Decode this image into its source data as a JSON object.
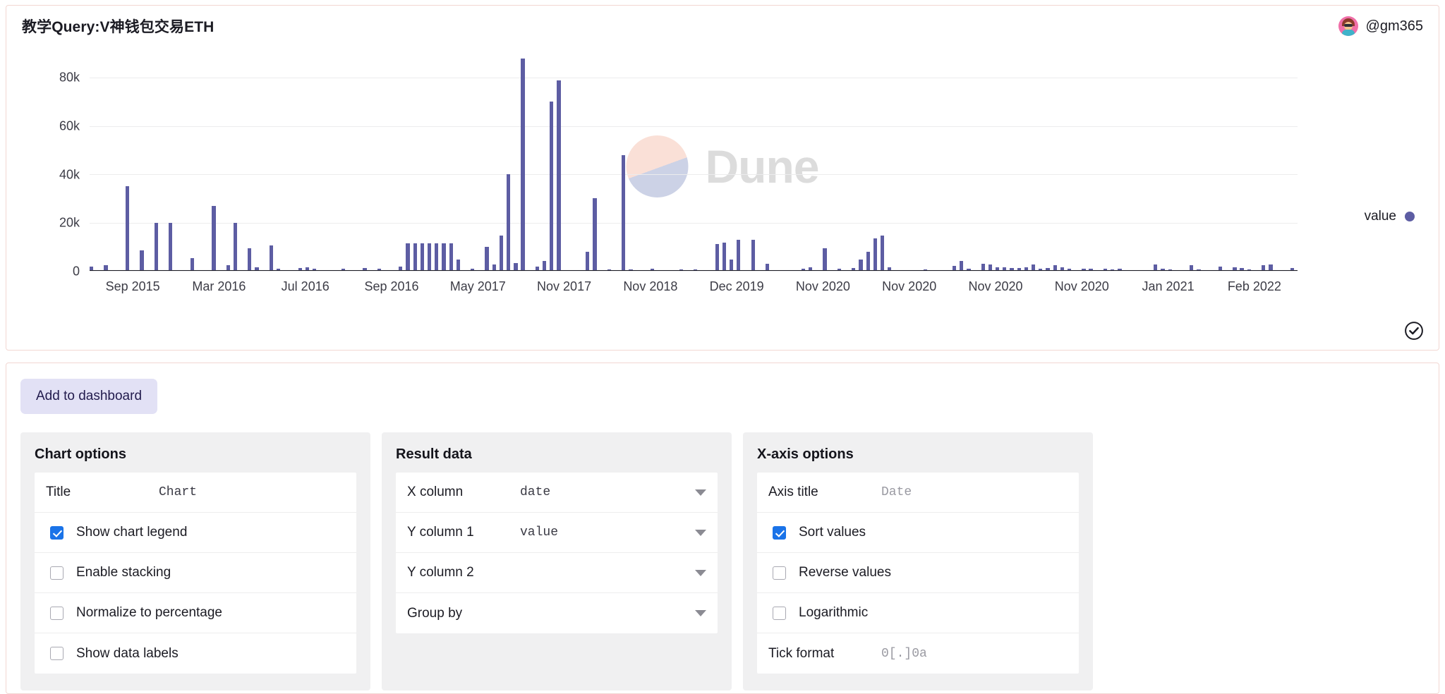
{
  "header": {
    "title": "教学Query:V神钱包交易ETH",
    "user_handle": "@gm365",
    "avatar_name": "user-avatar"
  },
  "chart_data": {
    "type": "bar",
    "title": "教学Query:V神钱包交易ETH",
    "xlabel": "",
    "ylabel": "",
    "ylim": [
      0,
      90000
    ],
    "grid": true,
    "legend_position": "right",
    "legend": [
      "value"
    ],
    "series_color": "#5d5da3",
    "ytick_labels": [
      "0",
      "20k",
      "40k",
      "60k",
      "80k"
    ],
    "ytick_values": [
      0,
      20000,
      40000,
      60000,
      80000
    ],
    "xtick_labels": [
      "Sep 2015",
      "Mar 2016",
      "Jul 2016",
      "Sep 2016",
      "May 2017",
      "Nov 2017",
      "Nov 2018",
      "Dec 2019",
      "Nov 2020",
      "Nov 2020",
      "Nov 2020",
      "Nov 2020",
      "Jan 2021",
      "Feb 2022"
    ],
    "series": [
      {
        "name": "value",
        "values": [
          1800,
          0,
          2400,
          0,
          0,
          35000,
          0,
          8500,
          0,
          20000,
          0,
          20000,
          0,
          0,
          5200,
          0,
          0,
          27000,
          0,
          2200,
          20000,
          0,
          9500,
          1400,
          0,
          10500,
          900,
          0,
          0,
          1200,
          1400,
          900,
          0,
          0,
          0,
          800,
          0,
          0,
          1100,
          0,
          900,
          0,
          0,
          1900,
          11500,
          11500,
          11500,
          11500,
          11500,
          11500,
          11500,
          4800,
          0,
          1000,
          0,
          9800,
          2600,
          14500,
          40000,
          3100,
          88000,
          0,
          1800,
          4200,
          70000,
          79000,
          0,
          0,
          0,
          7800,
          30000,
          0,
          700,
          0,
          48000,
          500,
          0,
          0,
          900,
          0,
          0,
          0,
          600,
          0,
          700,
          0,
          0,
          11000,
          11800,
          4800,
          13000,
          0,
          12800,
          0,
          3000,
          0,
          0,
          0,
          0,
          800,
          1400,
          0,
          9400,
          0,
          800,
          0,
          1100,
          4600,
          8000,
          13500,
          14500,
          1600,
          0,
          0,
          0,
          0,
          700,
          0,
          0,
          0,
          2100,
          4200,
          800,
          0,
          2900,
          2600,
          1600,
          1400,
          1200,
          1200,
          1400,
          2600,
          900,
          1200,
          2400,
          1400,
          900,
          0,
          800,
          900,
          0,
          800,
          700,
          900,
          0,
          0,
          0,
          0,
          2600,
          800,
          600,
          0,
          0,
          2400,
          600,
          0,
          0,
          1800,
          0,
          1500,
          1200,
          600,
          0,
          2400,
          2600,
          0,
          0,
          1100
        ]
      }
    ]
  },
  "chart_footer": {
    "status_icon": "check-circle-icon"
  },
  "options": {
    "add_to_dashboard_label": "Add to dashboard",
    "panels": [
      {
        "title": "Chart options",
        "rows": [
          {
            "kind": "field",
            "label": "Title",
            "value": "Chart",
            "placeholder": false,
            "name": "chart-title-field"
          },
          {
            "kind": "checkbox",
            "label": "Show chart legend",
            "checked": true,
            "name": "show-chart-legend-checkbox"
          },
          {
            "kind": "checkbox",
            "label": "Enable stacking",
            "checked": false,
            "name": "enable-stacking-checkbox"
          },
          {
            "kind": "checkbox",
            "label": "Normalize to percentage",
            "checked": false,
            "name": "normalize-to-percentage-checkbox"
          },
          {
            "kind": "checkbox",
            "label": "Show data labels",
            "checked": false,
            "name": "show-data-labels-checkbox"
          }
        ]
      },
      {
        "title": "Result data",
        "rows": [
          {
            "kind": "select",
            "label": "X column",
            "value": "date",
            "name": "x-column-select"
          },
          {
            "kind": "select",
            "label": "Y column 1",
            "value": "value",
            "name": "y-column-1-select"
          },
          {
            "kind": "select",
            "label": "Y column 2",
            "value": "",
            "name": "y-column-2-select"
          },
          {
            "kind": "select",
            "label": "Group by",
            "value": "",
            "name": "group-by-select"
          }
        ]
      },
      {
        "title": "X-axis options",
        "rows": [
          {
            "kind": "field",
            "label": "Axis title",
            "value": "Date",
            "placeholder": true,
            "name": "axis-title-field"
          },
          {
            "kind": "checkbox",
            "label": "Sort values",
            "checked": true,
            "name": "sort-values-checkbox"
          },
          {
            "kind": "checkbox",
            "label": "Reverse values",
            "checked": false,
            "name": "reverse-values-checkbox"
          },
          {
            "kind": "checkbox",
            "label": "Logarithmic",
            "checked": false,
            "name": "logarithmic-checkbox"
          },
          {
            "kind": "field",
            "label": "Tick format",
            "value": "0[.]0a",
            "placeholder": true,
            "name": "tick-format-field"
          }
        ]
      }
    ]
  },
  "watermark": {
    "text": "Dune"
  },
  "colors": {
    "bar": "#5d5da3",
    "card_border": "#f2d7d2",
    "panel_bg": "#f0f0f1",
    "accent_checkbox": "#1a73e8",
    "button_bg": "#e2e1f5"
  }
}
